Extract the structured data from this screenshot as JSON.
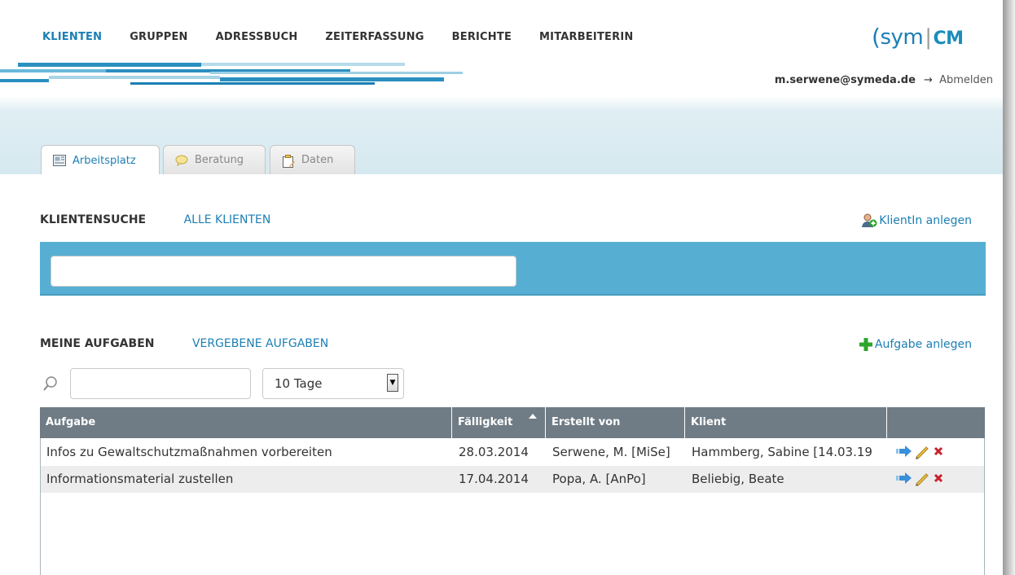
{
  "nav": {
    "items": [
      {
        "label": "KLIENTEN",
        "active": true
      },
      {
        "label": "GRUPPEN",
        "active": false
      },
      {
        "label": "ADRESSBUCH",
        "active": false
      },
      {
        "label": "ZEITERFASSUNG",
        "active": false
      },
      {
        "label": "BERICHTE",
        "active": false
      },
      {
        "label": "MITARBEITERIN",
        "active": false
      }
    ]
  },
  "logo": {
    "paren": "(",
    "left": "sym",
    "sep": "|",
    "right": "CM"
  },
  "user": {
    "email": "m.serwene@symeda.de",
    "arrow": "→",
    "logout": "Abmelden"
  },
  "tabs": [
    {
      "label": "Arbeitsplatz",
      "icon": "workspace-icon",
      "active": true
    },
    {
      "label": "Beratung",
      "icon": "speech-bubble-icon",
      "active": false
    },
    {
      "label": "Daten",
      "icon": "clipboard-icon",
      "active": false
    }
  ],
  "client_section": {
    "title": "KLIENTENSUCHE",
    "link": "ALLE KLIENTEN",
    "add_label": "KlientIn anlegen",
    "search_value": ""
  },
  "task_section": {
    "title": "MEINE AUFGABEN",
    "link": "VERGEBENE AUFGABEN",
    "add_label": "Aufgabe anlegen",
    "filter_value": "",
    "period": "10 Tage"
  },
  "table": {
    "columns": [
      "Aufgabe",
      "Fälligkeit",
      "Erstellt von",
      "Klient",
      ""
    ],
    "rows": [
      {
        "task": "Infos zu Gewaltschutzmaßnahmen vorbereiten",
        "due": "28.03.2014",
        "creator": "Serwene, M. [MiSe]",
        "client": "Hammberg, Sabine [14.03.19"
      },
      {
        "task": "Informationsmaterial zustellen",
        "due": "17.04.2014",
        "creator": "Popa, A. [AnPo]",
        "client": "Beliebig, Beate"
      }
    ]
  },
  "colors": {
    "accent": "#1b7fb4",
    "search_bar": "#56afd3",
    "table_header": "#707c85",
    "add_green": "#2fa52c",
    "delete_red": "#c8202a"
  }
}
